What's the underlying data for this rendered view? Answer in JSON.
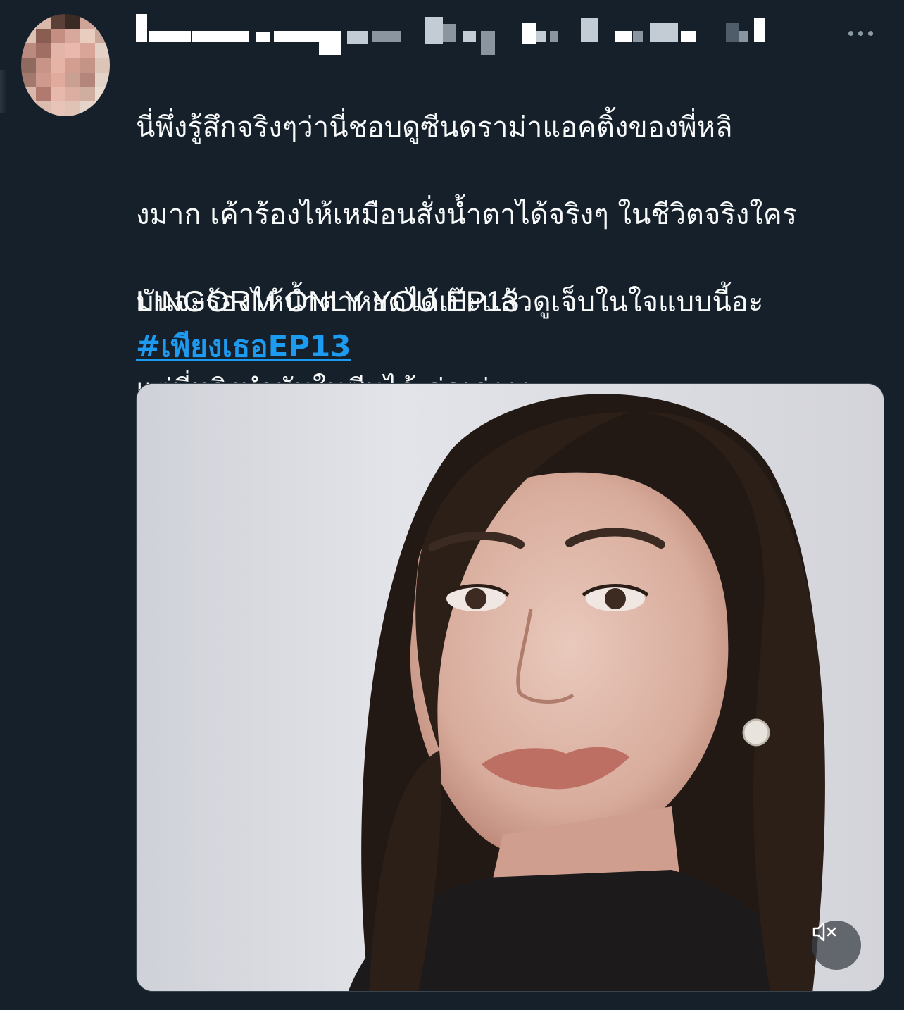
{
  "tweet": {
    "body_lines": [
      "นี่พึ่งรู้สึกจริงๆว่านี่ชอบดูซีนดราม่าแอคติ้งของพี่หลิ",
      "งมาก เค้าร้องไห้เหมือนสั่งน้ำตาได้จริงๆ ในชีวิตจริงใคร",
      "มันจะร้องไห้น้ำตาหยดได้เป๊ะแล้วดูเจ็บในใจแบบนี้อะ",
      "แต่พี่หลิงทำมันในซีนได้ ค่ดเก่งงง"
    ],
    "caption": "LINGORM ONLY YOU EP13",
    "hashtag": "#เพียงเธอEP13"
  },
  "icons": {
    "more": "more-horizontal-icon",
    "mute": "volume-muted-icon"
  },
  "colors": {
    "background": "#15202b",
    "text": "#f7f9f9",
    "link": "#1d9bf0",
    "muted": "#8b98a5"
  }
}
